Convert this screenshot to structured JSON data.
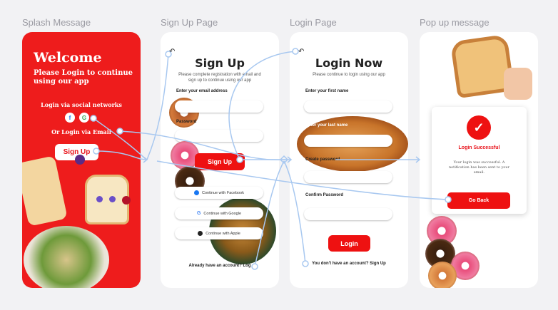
{
  "frame_labels": {
    "splash": "Splash Message",
    "signup": "Sign Up Page",
    "login": "Login Page",
    "popup": "Pop up message"
  },
  "splash": {
    "title": "Welcome",
    "subtitle": "Please Login to continue using our app",
    "social_text": "Login via social networks",
    "email_text": "Or Login via Email",
    "button": "Sign Up"
  },
  "signup": {
    "title": "Sign Up",
    "description": "Please complete registration with email and sign up to continue using our app",
    "email_label": "Enter your email address",
    "password_label": "Password",
    "button": "Sign Up",
    "facebook": "Continue with Facebook",
    "google": "Continue with Google",
    "apple": "Continue with Apple",
    "footer": "Already have an account? Log"
  },
  "login": {
    "title": "Login Now",
    "description": "Please continue to login using our app",
    "first_name_label": "Enter your first name",
    "last_name_label": "Enter your last name",
    "email_label": "Create password",
    "confirm_label": "Confirm Password",
    "button": "Login",
    "footer": "You don't have an account? Sign Up"
  },
  "popup": {
    "title": "Login Successful",
    "message": "Your login was successful. A notification has been sent to your email.",
    "button": "Go Back"
  },
  "colors": {
    "brand_red": "#ee1c1c",
    "link_blue": "#a8c8f0"
  }
}
